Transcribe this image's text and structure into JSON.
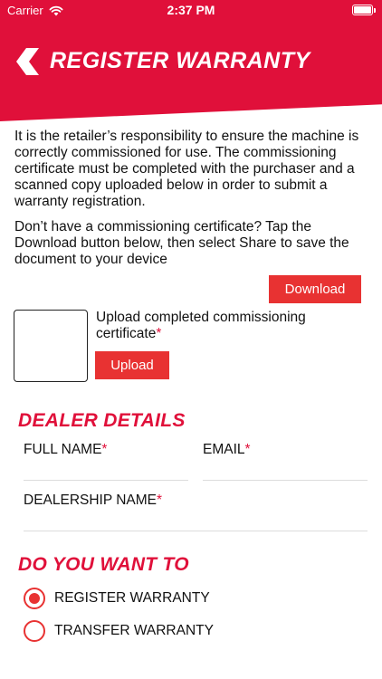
{
  "status_bar": {
    "carrier": "Carrier",
    "time": "2:37 PM"
  },
  "header": {
    "title": "REGISTER WARRANTY"
  },
  "intro": {
    "paragraph1": "It is the retailer’s responsibility to ensure the machine is correctly commissioned for use. The commissioning certificate must be completed with the purchaser and a scanned copy uploaded below in order to submit a warranty registration.",
    "paragraph2": "Don’t have a commissioning certificate? Tap the Download button below, then select Share to save the document to your device"
  },
  "download_label": "Download",
  "upload": {
    "label": "Upload completed commissioning certificate",
    "required_mark": "*",
    "button_label": "Upload"
  },
  "dealer_details": {
    "title": "DEALER DETAILS",
    "full_name_label": "FULL NAME",
    "email_label": "EMAIL",
    "dealership_name_label": "DEALERSHIP NAME",
    "required_mark": "*"
  },
  "options": {
    "title": "DO YOU WANT TO",
    "items": [
      {
        "label": "REGISTER WARRANTY",
        "selected": true
      },
      {
        "label": "TRANSFER WARRANTY",
        "selected": false
      }
    ]
  },
  "colors": {
    "brand_red": "#e0103a",
    "button_red": "#e83232"
  },
  "icons": {
    "back": "chevron-left-icon",
    "wifi": "wifi-icon",
    "battery": "battery-icon"
  }
}
